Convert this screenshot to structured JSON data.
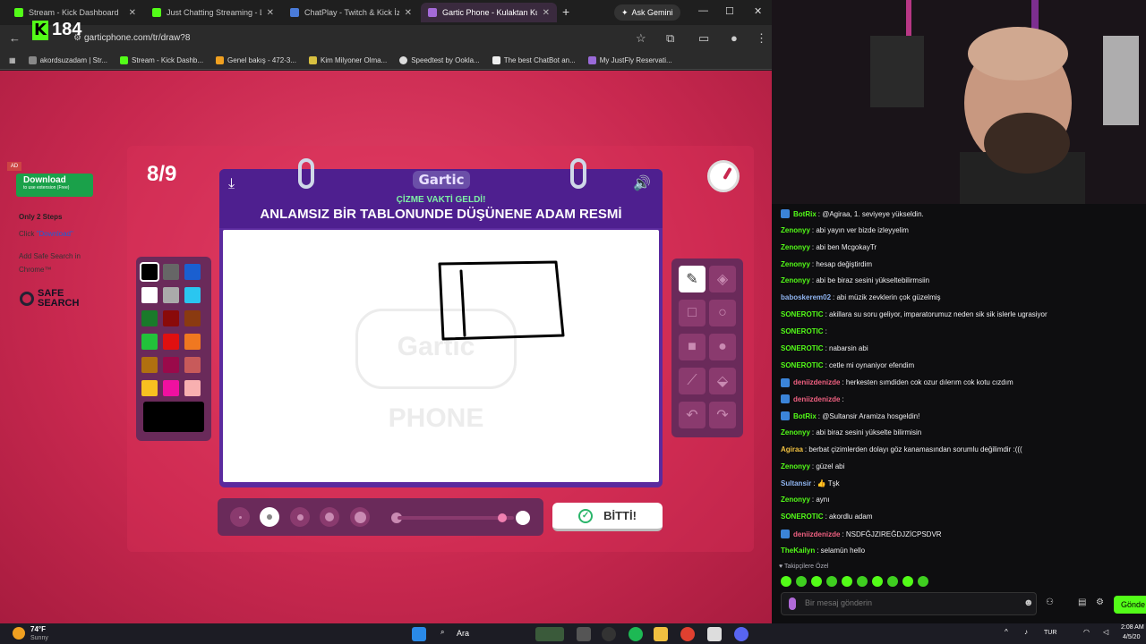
{
  "browser": {
    "tabs": [
      {
        "label": "Stream - Kick Dashboard",
        "color": "#53fc18"
      },
      {
        "label": "Just Chatting Streaming - Live",
        "color": "#53fc18"
      },
      {
        "label": "ChatPlay - Twitch & Kick İzley",
        "color": "#4a7bd8"
      },
      {
        "label": "Gartic Phone - Kulaktan Kulağ",
        "color": "#a46ad8"
      }
    ],
    "ask_gemini": "Ask Gemini",
    "url": "garticphone.com/tr/draw?8",
    "kick_count": "184",
    "bookmarks": [
      "akordsuzadam | Str...",
      "Stream - Kick Dashb...",
      "Genel bakış - 472-3...",
      "Kim Milyoner Olma...",
      "Speedtest by Ookla...",
      "The best ChatBot an...",
      "My JustFly Reservati..."
    ]
  },
  "ad": {
    "tag": "AD",
    "download_title": "Download",
    "download_sub": "to use extension (Free)",
    "steps_title": "Only 2 Steps",
    "step1_prefix": "Click ",
    "step1_link": "\"Download\"",
    "step2": "Add Safe Search in Chrome™",
    "brand": "SAFE SEARCH"
  },
  "game": {
    "round": "8/9",
    "logo": "Gartic",
    "subtitle": "ÇİZME VAKTİ GELDİ!",
    "title": "ANLAMSIZ BİR TABLONUNDE DÜŞÜNENE ADAM RESMİ",
    "watermark": "Gartic PHONE",
    "palette": [
      "#000000",
      "#666666",
      "#1a5fd0",
      "#ffffff",
      "#aaaaaa",
      "#2ac6f0",
      "#1a7a2a",
      "#8a0a0a",
      "#8a3a10",
      "#22c23a",
      "#e01010",
      "#f07820",
      "#b07010",
      "#9a0a4a",
      "#c85a5a",
      "#f8c020",
      "#f010a0",
      "#f8b0b0"
    ],
    "current_color": "#000000",
    "done_label": "BİTTİ!",
    "selected_tool": "pencil",
    "selected_size_index": 1,
    "opacity": 1.0
  },
  "chat": {
    "messages": [
      {
        "user": "BotRix",
        "color": "#53fc18",
        "text": ": @Agiraa, 1. seviyeye yükseldin.",
        "badge": true
      },
      {
        "user": "Zenonyy",
        "color": "#53fc18",
        "text": ": abi yayın ver bizde izleyyelim"
      },
      {
        "user": "Zenonyy",
        "color": "#53fc18",
        "text": ": abi ben McgokayTr"
      },
      {
        "user": "Zenonyy",
        "color": "#53fc18",
        "text": ": hesap değiştirdim"
      },
      {
        "user": "Zenonyy",
        "color": "#53fc18",
        "text": ": abi be biraz sesini yükseltebilirmsiin"
      },
      {
        "user": "baboskerem02",
        "color": "#8fb4f0",
        "text": ": abi müzik zevklerin çok güzelmiş"
      },
      {
        "user": "SONEROTIC",
        "color": "#53fc18",
        "text": ": akillara su soru geliyor, imparatorumuz neden sik sik islerle ugrasiyor"
      },
      {
        "user": "SONEROTIC",
        "color": "#53fc18",
        "text": ":"
      },
      {
        "user": "SONEROTIC",
        "color": "#53fc18",
        "text": ": nabarsin abi"
      },
      {
        "user": "SONEROTIC",
        "color": "#53fc18",
        "text": ": cetle mi oynaniyor efendim"
      },
      {
        "user": "deniizdenizde",
        "color": "#f06080",
        "text": ": herkesten sımdiden cok ozur dılerım cok kotu cızdım",
        "badge": true
      },
      {
        "user": "deniizdenizde",
        "color": "#f06080",
        "text": ":",
        "badge": true
      },
      {
        "user": "BotRix",
        "color": "#53fc18",
        "text": ": @Sultansir Aramiza hosgeldin!",
        "badge": true
      },
      {
        "user": "Zenonyy",
        "color": "#53fc18",
        "text": ": abi biraz sesini yükselte bilirmisin"
      },
      {
        "user": "Agiraa",
        "color": "#f0c040",
        "text": ": berbat çizimlerden dolayı göz kanamasından sorumlu değilimdir :((("
      },
      {
        "user": "Zenonyy",
        "color": "#53fc18",
        "text": ": güzel abi"
      },
      {
        "user": "Sultansir",
        "color": "#8fb4f0",
        "text": ": 👍 Tşk"
      },
      {
        "user": "Zenonyy",
        "color": "#53fc18",
        "text": ": aynı"
      },
      {
        "user": "SONEROTIC",
        "color": "#53fc18",
        "text": ": akordlu adam"
      },
      {
        "user": "deniizdenizde",
        "color": "#f06080",
        "text": ": NSDFĞJZIREĞDJZİCPSDVR",
        "badge": true
      },
      {
        "user": "TheKailyn",
        "color": "#53fc18",
        "text": ": selamün hello"
      }
    ],
    "followers_only": "Takipçilere Özel",
    "input_placeholder": "Bir mesaj gönderin",
    "send_label": "Gönde"
  },
  "taskbar": {
    "temp": "74°F",
    "weather": "Sunny",
    "search": "Ara",
    "lang": "TUR",
    "time": "2:08 AM",
    "date": "4/5/20"
  }
}
